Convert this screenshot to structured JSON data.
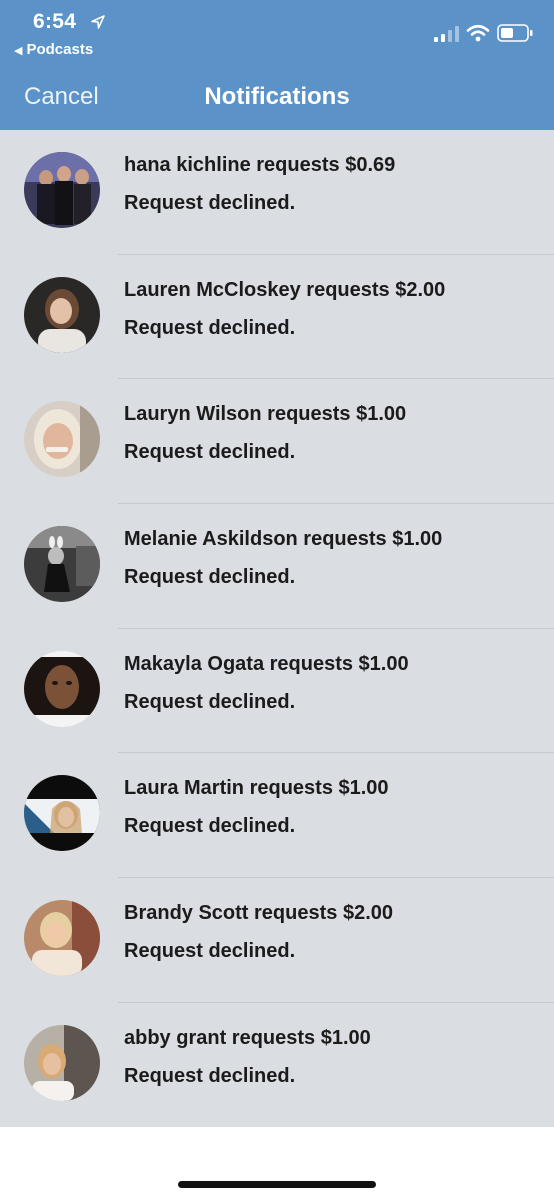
{
  "status_bar": {
    "time": "6:54",
    "back_app": "Podcasts",
    "icons": [
      "location-arrow-icon",
      "cellular-signal-icon",
      "wifi-icon",
      "battery-icon"
    ]
  },
  "nav": {
    "cancel_label": "Cancel",
    "title": "Notifications"
  },
  "colors": {
    "nav_background": "#5b93c8",
    "list_background": "#dadde1",
    "text": "#1b1b1b"
  },
  "notifications": [
    {
      "headline": "hana kichline requests $0.69",
      "status": "Request declined."
    },
    {
      "headline": "Lauren McCloskey requests $2.00",
      "status": "Request declined."
    },
    {
      "headline": "Lauryn Wilson requests $1.00",
      "status": "Request declined."
    },
    {
      "headline": "Melanie Askildson requests $1.00",
      "status": "Request declined."
    },
    {
      "headline": "Makayla Ogata requests $1.00",
      "status": "Request declined."
    },
    {
      "headline": "Laura Martin requests $1.00",
      "status": "Request declined."
    },
    {
      "headline": "Brandy Scott requests $2.00",
      "status": "Request declined."
    },
    {
      "headline": "abby grant requests $1.00",
      "status": "Request declined."
    }
  ]
}
